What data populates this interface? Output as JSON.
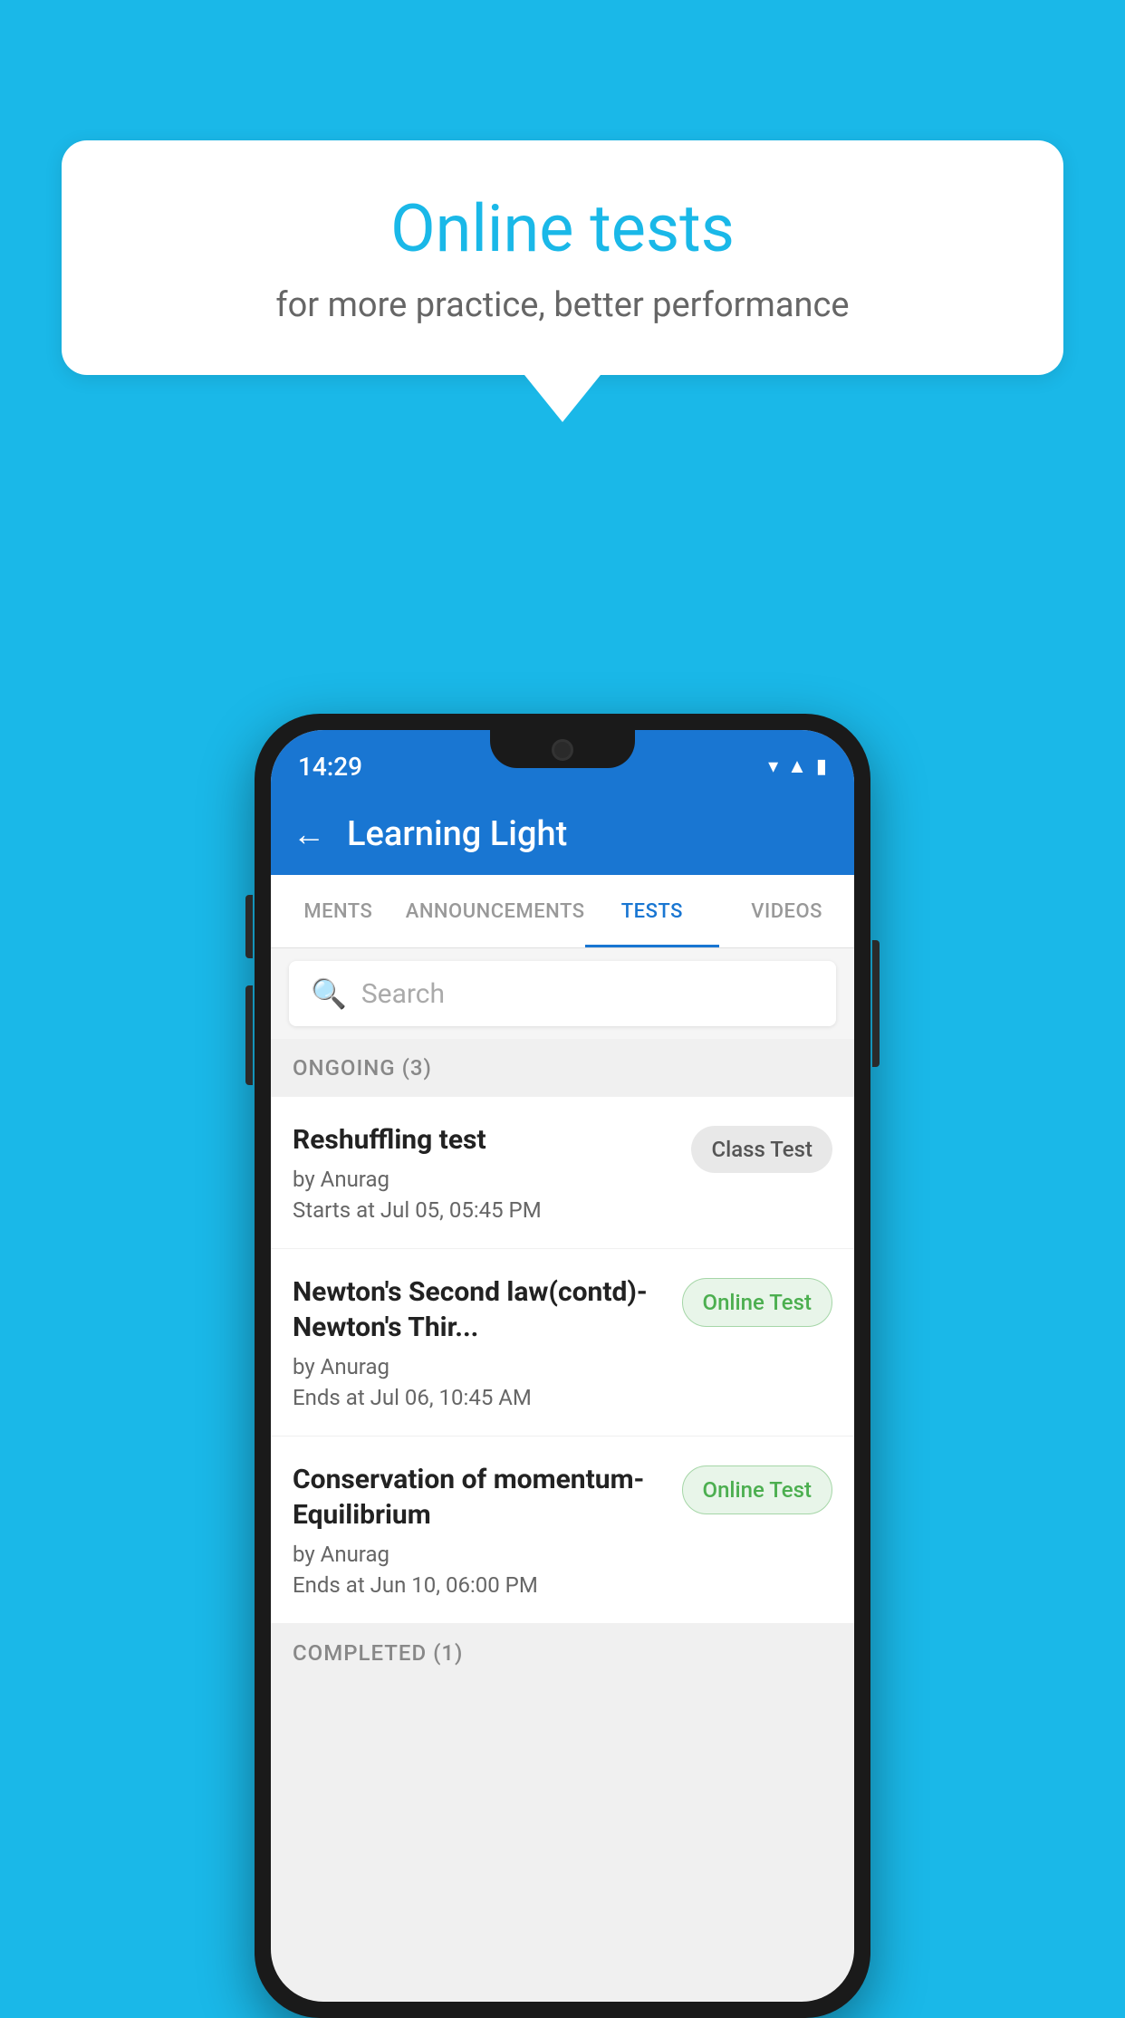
{
  "background_color": "#1ab8e8",
  "speech_bubble": {
    "title": "Online tests",
    "subtitle": "for more practice, better performance"
  },
  "phone": {
    "status_bar": {
      "time": "14:29",
      "icons": [
        "wifi",
        "signal",
        "battery"
      ]
    },
    "app_bar": {
      "back_label": "←",
      "title": "Learning Light"
    },
    "tabs": [
      {
        "label": "MENTS",
        "active": false
      },
      {
        "label": "ANNOUNCEMENTS",
        "active": false
      },
      {
        "label": "TESTS",
        "active": true
      },
      {
        "label": "VIDEOS",
        "active": false
      }
    ],
    "search": {
      "placeholder": "Search"
    },
    "ongoing_section": {
      "label": "ONGOING (3)"
    },
    "test_items": [
      {
        "name": "Reshuffling test",
        "author": "by Anurag",
        "date_label": "Starts at  Jul 05, 05:45 PM",
        "badge": "Class Test",
        "badge_type": "class"
      },
      {
        "name": "Newton's Second law(contd)-Newton's Thir...",
        "author": "by Anurag",
        "date_label": "Ends at  Jul 06, 10:45 AM",
        "badge": "Online Test",
        "badge_type": "online"
      },
      {
        "name": "Conservation of momentum-Equilibrium",
        "author": "by Anurag",
        "date_label": "Ends at  Jun 10, 06:00 PM",
        "badge": "Online Test",
        "badge_type": "online"
      }
    ],
    "completed_section": {
      "label": "COMPLETED (1)"
    }
  }
}
